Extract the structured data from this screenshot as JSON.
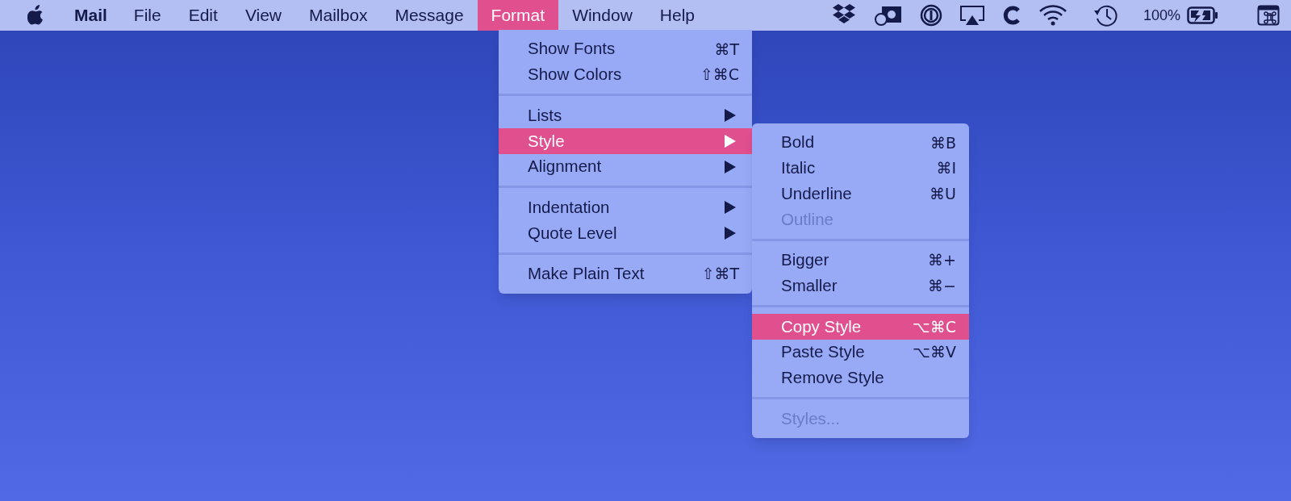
{
  "menu_bar": {
    "app_name": "Mail",
    "items": [
      {
        "label": "File",
        "selected": false
      },
      {
        "label": "Edit",
        "selected": false
      },
      {
        "label": "View",
        "selected": false
      },
      {
        "label": "Mailbox",
        "selected": false
      },
      {
        "label": "Message",
        "selected": false
      },
      {
        "label": "Format",
        "selected": true
      },
      {
        "label": "Window",
        "selected": false
      },
      {
        "label": "Help",
        "selected": false
      }
    ],
    "status": {
      "battery_text": "100%"
    }
  },
  "format_menu": {
    "items": [
      {
        "kind": "item",
        "label": "Show Fonts",
        "shortcut": "⌘T",
        "submenu": false,
        "selected": false,
        "disabled": false
      },
      {
        "kind": "item",
        "label": "Show Colors",
        "shortcut": "⇧⌘C",
        "submenu": false,
        "selected": false,
        "disabled": false
      },
      {
        "kind": "separator"
      },
      {
        "kind": "item",
        "label": "Lists",
        "submenu": true,
        "selected": false,
        "disabled": false
      },
      {
        "kind": "item",
        "label": "Style",
        "submenu": true,
        "selected": true,
        "disabled": false
      },
      {
        "kind": "item",
        "label": "Alignment",
        "submenu": true,
        "selected": false,
        "disabled": false
      },
      {
        "kind": "separator"
      },
      {
        "kind": "item",
        "label": "Indentation",
        "submenu": true,
        "selected": false,
        "disabled": false
      },
      {
        "kind": "item",
        "label": "Quote Level",
        "submenu": true,
        "selected": false,
        "disabled": false
      },
      {
        "kind": "separator"
      },
      {
        "kind": "item",
        "label": "Make Plain Text",
        "shortcut": "⇧⌘T",
        "submenu": false,
        "selected": false,
        "disabled": false
      }
    ]
  },
  "style_submenu": {
    "items": [
      {
        "kind": "item",
        "label": "Bold",
        "shortcut": "⌘B",
        "submenu": false,
        "selected": false,
        "disabled": false
      },
      {
        "kind": "item",
        "label": "Italic",
        "shortcut": "⌘I",
        "submenu": false,
        "selected": false,
        "disabled": false
      },
      {
        "kind": "item",
        "label": "Underline",
        "shortcut": "⌘U",
        "submenu": false,
        "selected": false,
        "disabled": false
      },
      {
        "kind": "item",
        "label": "Outline",
        "submenu": false,
        "selected": false,
        "disabled": true
      },
      {
        "kind": "separator"
      },
      {
        "kind": "item",
        "label": "Bigger",
        "shortcut": "⌘+",
        "submenu": false,
        "selected": false,
        "disabled": false
      },
      {
        "kind": "item",
        "label": "Smaller",
        "shortcut": "⌘−",
        "submenu": false,
        "selected": false,
        "disabled": false
      },
      {
        "kind": "separator"
      },
      {
        "kind": "item",
        "label": "Copy Style",
        "shortcut": "⌥⌘C",
        "submenu": false,
        "selected": true,
        "disabled": false
      },
      {
        "kind": "item",
        "label": "Paste Style",
        "shortcut": "⌥⌘V",
        "submenu": false,
        "selected": false,
        "disabled": false
      },
      {
        "kind": "item",
        "label": "Remove Style",
        "submenu": false,
        "selected": false,
        "disabled": false
      },
      {
        "kind": "separator"
      },
      {
        "kind": "item",
        "label": "Styles...",
        "submenu": false,
        "selected": false,
        "disabled": true
      }
    ]
  }
}
